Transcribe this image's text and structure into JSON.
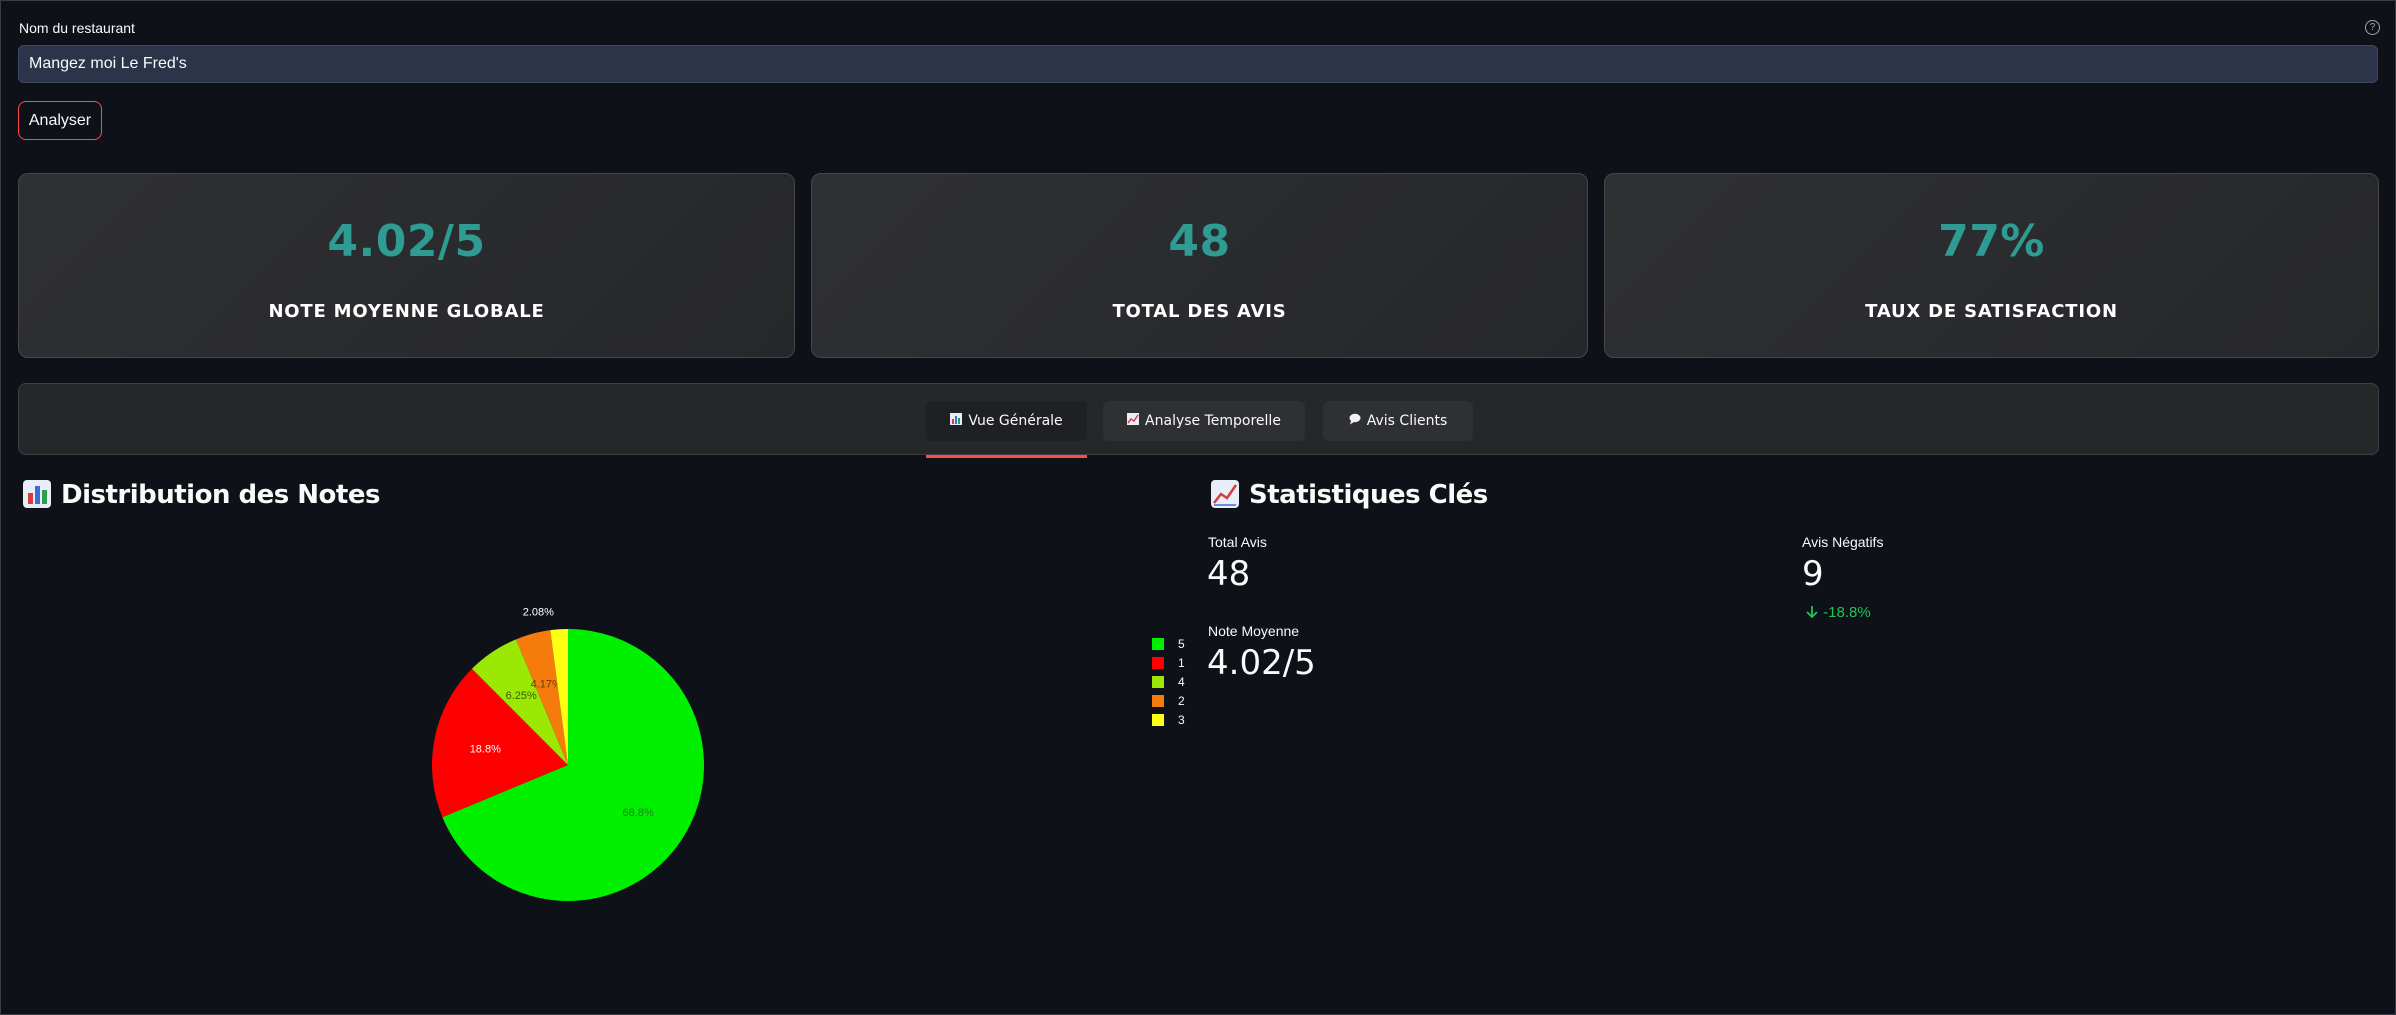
{
  "form": {
    "label": "Nom du restaurant",
    "value": "Mangez moi Le Fred's",
    "help_icon": "help-circle-icon",
    "button_label": "Analyser"
  },
  "kpis": [
    {
      "value": "4.02/5",
      "label": "NOTE MOYENNE GLOBALE"
    },
    {
      "value": "48",
      "label": "TOTAL DES AVIS"
    },
    {
      "value": "77%",
      "label": "TAUX DE SATISFACTION"
    }
  ],
  "tabs": [
    {
      "label": "Vue Générale",
      "icon": "bar-chart-icon",
      "active": true
    },
    {
      "label": "Analyse Temporelle",
      "icon": "line-chart-icon",
      "active": false
    },
    {
      "label": "Avis Clients",
      "icon": "speech-bubble-icon",
      "active": false
    }
  ],
  "distribution": {
    "title": "Distribution des Notes",
    "icon": "bar-chart-icon"
  },
  "stats": {
    "title": "Statistiques Clés",
    "icon": "line-chart-icon",
    "total_label": "Total Avis",
    "total_value": "48",
    "negative_label": "Avis Négatifs",
    "negative_value": "9",
    "negative_delta": "-18.8%",
    "average_label": "Note Moyenne",
    "average_value": "4.02/5"
  },
  "colors": {
    "background": "#0e1117",
    "accent": "#2e9c92",
    "tab_underline": "#ff4b4b",
    "delta_negative": "#21c354"
  },
  "chart_data": {
    "type": "pie",
    "labels": [
      "5",
      "1",
      "4",
      "2",
      "3"
    ],
    "values": [
      68.8,
      18.8,
      6.25,
      4.17,
      2.08
    ],
    "value_labels": [
      "68.8%",
      "18.8%",
      "6.25%",
      "4.17%",
      "2.08%"
    ],
    "colors": [
      "#00f000",
      "#ff0000",
      "#9be804",
      "#f57c0c",
      "#ffff14"
    ],
    "legend": [
      "5",
      "1",
      "4",
      "2",
      "3"
    ],
    "legend_position": "right"
  }
}
